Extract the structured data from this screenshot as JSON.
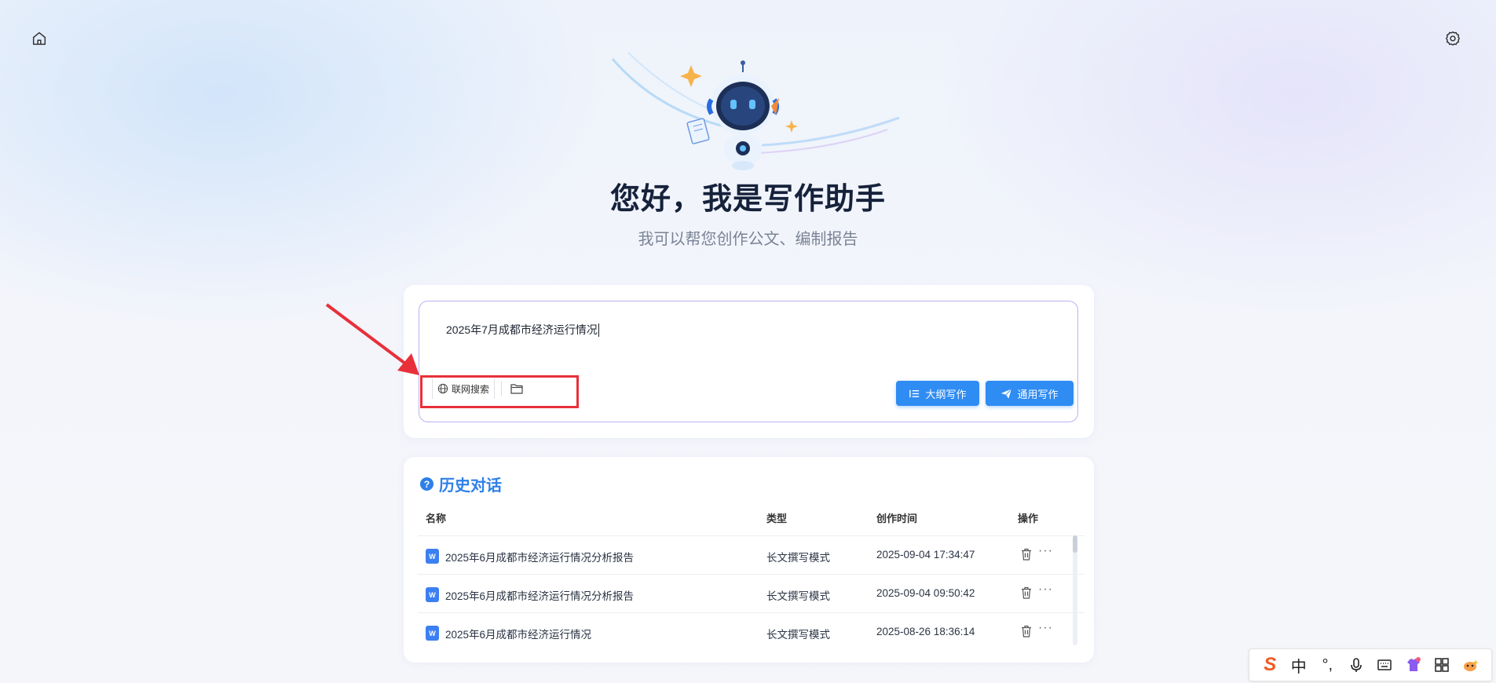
{
  "header": {
    "home_icon": "home-icon",
    "settings_icon": "gear-icon"
  },
  "hero": {
    "title": "您好，我是写作助手",
    "subtitle": "我可以帮您创作公文、编制报告"
  },
  "input": {
    "value": "2025年7月成都市经济运行情况",
    "web_search_label": "联网搜索",
    "outline_button": "大纲写作",
    "general_button": "通用写作"
  },
  "history": {
    "title": "历史对话",
    "columns": {
      "name": "名称",
      "type": "类型",
      "time": "创作时间",
      "op": "操作"
    },
    "rows": [
      {
        "name": "2025年6月成都市经济运行情况分析报告",
        "type": "长文撰写模式",
        "time": "2025-09-04 17:34:47",
        "more": "···"
      },
      {
        "name": "2025年6月成都市经济运行情况分析报告",
        "type": "长文撰写模式",
        "time": "2025-09-04 09:50:42",
        "more": "···"
      },
      {
        "name": "2025年6月成都市经济运行情况",
        "type": "长文撰写模式",
        "time": "2025-08-26 18:36:14",
        "more": "···"
      }
    ],
    "doc_badge": "W"
  },
  "ime": {
    "lang": "中",
    "punct": "°,"
  },
  "colors": {
    "accent": "#2f8cf3",
    "highlight": "#e8303a",
    "title": "#16223b",
    "history_title": "#2e80e8"
  }
}
